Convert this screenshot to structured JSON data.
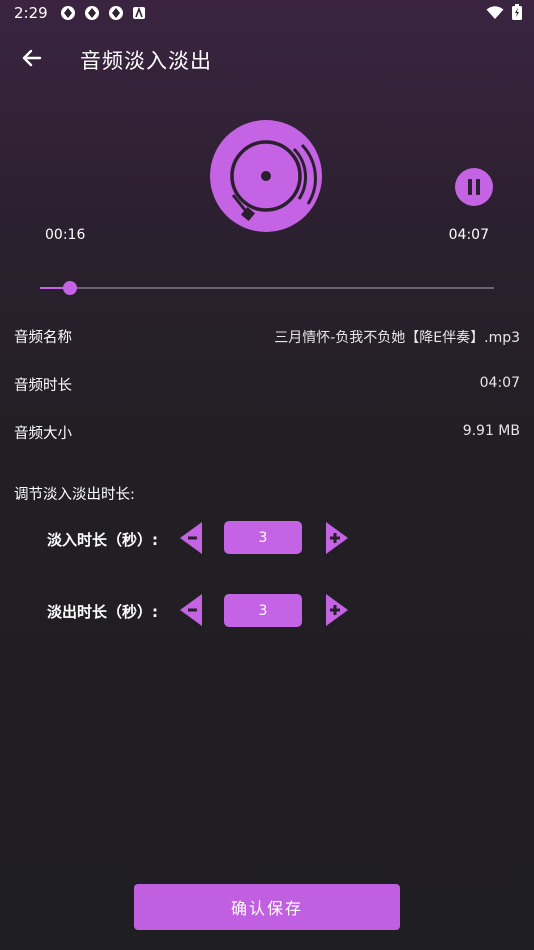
{
  "status_bar": {
    "time": "2:29"
  },
  "header": {
    "title": "音频淡入淡出"
  },
  "player": {
    "current_time": "00:16",
    "total_time": "04:07",
    "progress": 0.065
  },
  "info": [
    {
      "label": "音频名称",
      "value": "三月情怀-负我不负她【降E伴奏】.mp3"
    },
    {
      "label": "音频时长",
      "value": "04:07"
    },
    {
      "label": "音频大小",
      "value": "9.91 MB"
    }
  ],
  "adjust": {
    "section_title": "调节淡入淡出时长:",
    "fade_in": {
      "label": "淡入时长（秒）:",
      "value": "3"
    },
    "fade_out": {
      "label": "淡出时长（秒）:",
      "value": "3"
    }
  },
  "footer": {
    "confirm_label": "确认保存"
  },
  "colors": {
    "accent": "#c463e3",
    "background": "#1f1e21"
  }
}
